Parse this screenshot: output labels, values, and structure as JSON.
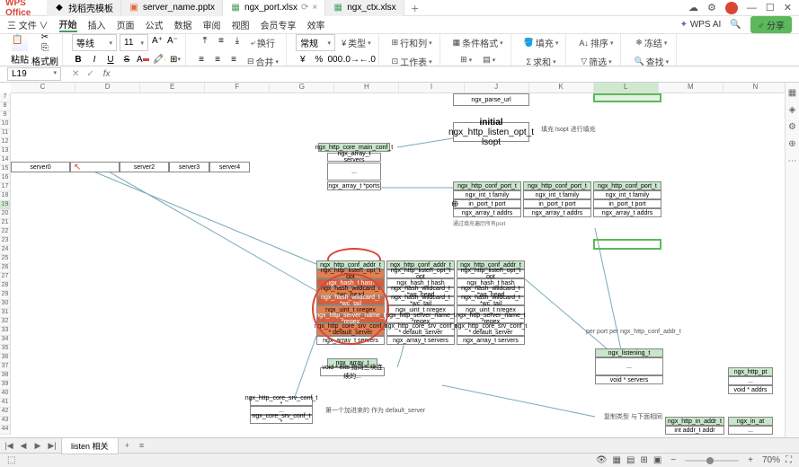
{
  "app": {
    "name": "WPS Office"
  },
  "tabs": [
    {
      "label": "找稻壳模板",
      "icon_color": "#d94636"
    },
    {
      "label": "server_name.pptx",
      "icon_color": "#e86438"
    },
    {
      "label": "ngx_port.xlsx",
      "icon_color": "#4a9d5b",
      "active": true,
      "modified": true
    },
    {
      "label": "ngx_ctx.xlsx",
      "icon_color": "#4a9d5b"
    }
  ],
  "menu": {
    "file": "三 文件 ∨",
    "items": [
      "开始",
      "插入",
      "页面",
      "公式",
      "数据",
      "审阅",
      "视图",
      "会员专享",
      "效率"
    ],
    "wpsai": "WPS AI",
    "share": "分享"
  },
  "toolbar": {
    "paste": "粘贴",
    "format_brush": "格式刷",
    "font": "等线",
    "size": "11",
    "wrap": "换行",
    "merge": "合并",
    "general": "常规",
    "type": "类型",
    "row_col": "行和列",
    "worksheet": "工作表",
    "cond_fmt": "条件格式",
    "fill": "填充",
    "sort": "排序",
    "freeze": "冻结",
    "sum": "求和",
    "filter": "筛选",
    "find": "查找"
  },
  "formula": {
    "cell": "L19"
  },
  "columns": [
    "C",
    "D",
    "E",
    "F",
    "G",
    "H",
    "I",
    "J",
    "K",
    "L",
    "M",
    "N"
  ],
  "rows": [
    "7",
    "8",
    "9",
    "10",
    "11",
    "12",
    "13",
    "14",
    "15",
    "16",
    "17",
    "18",
    "19",
    "20",
    "21",
    "22",
    "23",
    "24",
    "25",
    "26",
    "27",
    "28",
    "29",
    "30",
    "31",
    "32",
    "33",
    "34",
    "35",
    "36",
    "37",
    "38",
    "39",
    "40",
    "41",
    "42",
    "43",
    "44"
  ],
  "diagram": {
    "parse_url": "ngx_parse_url",
    "initial": "initial",
    "initial2": "ngx_http_listen_opt_t lsopt",
    "note1": "填充 lsopt 进行填充",
    "core_main": "ngx_http_core_main_conf_t",
    "array_servers": "ngx_array_t servers",
    "array_ports": "ngx_array_t *ports",
    "servers": [
      "server0",
      "",
      "server2",
      "server3",
      "server4"
    ],
    "conf_port": "ngx_http_conf_port_t",
    "family": "ngx_int_t family",
    "port": "in_port_t port",
    "addrs": "ngx_array_t addrs",
    "port_note": "通过填充遍历所有port",
    "conf_addr": "ngx_http_conf_addr_t",
    "listen_opt": "ngx_http_listen_opt_t opt",
    "hash": "ngx_hash_t hash",
    "wc_head": "ngx_hash_wildcard_t *wc_head",
    "wc_tail": "ngx_hash_wildcard_t *wc_tail",
    "nregex": "ngx_uint_t nregex",
    "server_name": "ngx_http_server_name_t *regex",
    "default_srv": "ngx_http_core_srv_conf_t *  default_server",
    "arr_servers": "ngx_array_t servers",
    "array_t": "ngx_array_t",
    "void_elts": "void * elts 指向三块连续的...",
    "srv_conf": "ngx_http_core_srv_conf_t *",
    "core_srv": "ngx_core_srv_conf_t *",
    "default_note": "第一个加进来的 作为 default_server",
    "listening": "ngx_listening_t",
    "void_servers": "void * servers",
    "per_port": "per port per ngx_http_conf_addr_t",
    "http_pt": "ngx_http_pt",
    "void_addrs": "void * addrs",
    "in_addr": "ngx_http_in_addr_t",
    "ngx_in_at": "ngx_in_at",
    "addr_field": "int addr_t addr",
    "copy_note": "复制类型  与下面相同"
  },
  "sheet_tab": "listen 相关",
  "status": {
    "zoom": "70%"
  }
}
